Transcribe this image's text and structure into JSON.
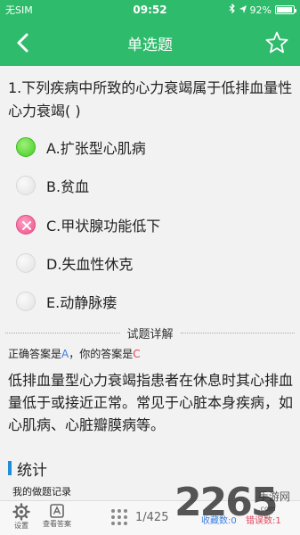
{
  "status_bar": {
    "carrier": "无SIM",
    "time": "09:52",
    "battery": "92%",
    "battery_level": 0.92
  },
  "nav": {
    "title": "单选题"
  },
  "question": {
    "text": "1.下列疾病中所致的心力衰竭属于低排血量性心力衰竭( )"
  },
  "options": [
    {
      "label": "A.扩张型心肌病",
      "state": "correct"
    },
    {
      "label": "B.贫血",
      "state": "empty"
    },
    {
      "label": "C.甲状腺功能低下",
      "state": "wrong"
    },
    {
      "label": "D.失血性休克",
      "state": "empty"
    },
    {
      "label": "E.动静脉瘘",
      "state": "empty"
    }
  ],
  "explanation": {
    "header": "试题详解",
    "answer_prefix": "正确答案是",
    "correct_letter": "A",
    "mine_prefix": "，你的答案是",
    "my_letter": "C",
    "text": "低排血量型心力衰竭指患者在休息时其心排血量低于或接近正常。常见于心脏本身疾病，如心肌病、心脏瓣膜病等。"
  },
  "stats": {
    "title": "统计",
    "record_label": "我的做题记录"
  },
  "bottom_bar": {
    "settings_label": "设置",
    "view_answer_label": "查看答案",
    "progress": "1/425",
    "favorites": "收藏数:0",
    "errors": "错误数:1"
  },
  "watermark": {
    "number": "2265",
    "cn": "手游网",
    "url": ".com"
  },
  "colors": {
    "brand": "#2ebb6b",
    "correct": "#42cc22",
    "wrong": "#ee4f8a",
    "accent_blue": "#3a7fe0"
  }
}
